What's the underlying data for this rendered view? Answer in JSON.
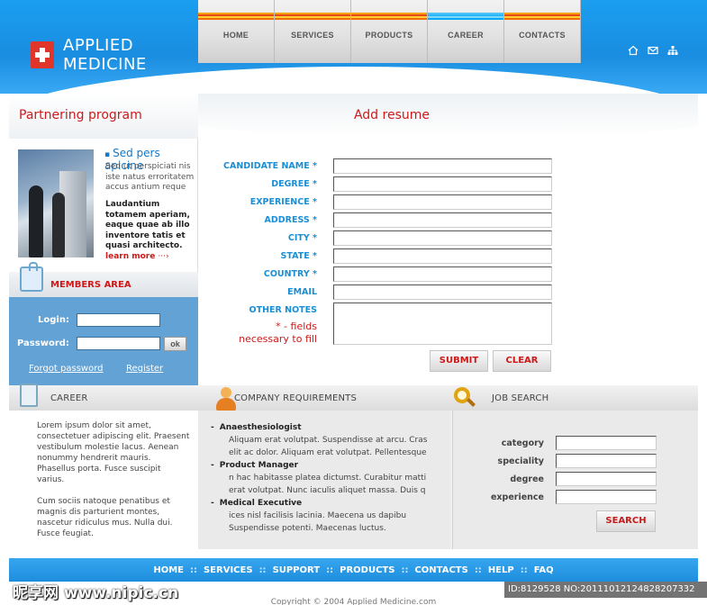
{
  "brand": {
    "line1": "APPLIED",
    "line2": "MEDICINE"
  },
  "nav": [
    {
      "label": "HOME"
    },
    {
      "label": "SERVICES"
    },
    {
      "label": "PRODUCTS"
    },
    {
      "label": "CAREER",
      "active": true
    },
    {
      "label": "CONTACTS"
    }
  ],
  "header_icons": [
    "home-icon",
    "mail-icon",
    "sitemap-icon"
  ],
  "sidebar": {
    "title": "Partnering program",
    "subtitle": "Sed pers apicine",
    "para1": "Sed ut perspiciati nis iste natus erroritatem accus antium reque",
    "para2": "Laudantium totamem aperiam, eaque quae ab illo inventore tatis et quasi architecto.",
    "learn_more": "learn more",
    "members_title": "MEMBERS AREA",
    "login_label": "Login:",
    "password_label": "Password:",
    "ok_label": "ok",
    "forgot": "Forgot password",
    "register": "Register"
  },
  "form": {
    "title": "Add resume",
    "fields": [
      {
        "label": "CANDIDATE NAME *",
        "value": ""
      },
      {
        "label": "DEGREE *",
        "value": ""
      },
      {
        "label": "EXPERIENCE *",
        "value": ""
      },
      {
        "label": "ADDRESS *",
        "value": ""
      },
      {
        "label": "CITY *",
        "value": ""
      },
      {
        "label": "STATE *",
        "value": ""
      },
      {
        "label": "COUNTRY *",
        "value": ""
      },
      {
        "label": "EMAIL",
        "value": ""
      }
    ],
    "notes_label": "OTHER NOTES",
    "required_note_1": "* - fields",
    "required_note_2": "necessary to fill",
    "submit": "SUBMIT",
    "clear": "CLEAR"
  },
  "career": {
    "title": "CAREER",
    "p1": "Lorem ipsum dolor sit amet, consectetuer adipiscing elit. Praesent vestibulum molestie lacus. Aenean nonummy hendrerit mauris. Phasellus porta. Fusce suscipit varius.",
    "p2": "Cum sociis natoque penatibus et magnis dis parturient montes, nascetur ridiculus mus. Nulla dui. Fusce feugiat."
  },
  "requirements": {
    "title": "COMPANY REQUIREMENTS",
    "items": [
      {
        "title": "Anaesthesiologist",
        "desc": "Aliquam erat volutpat. Suspendisse at arcu. Cras elit ac dolor. Aliquam erat volutpat. Pellentesque"
      },
      {
        "title": "Product Manager",
        "desc": "n hac habitasse platea dictumst. Curabitur matti erat volutpat. Nunc iaculis aliquet massa. Duis q"
      },
      {
        "title": "Medical Executive",
        "desc": "ices nisl facilisis lacinia. Maecena us dapibu Suspendisse potenti.  Maecenas luctus."
      }
    ]
  },
  "job_search": {
    "title": "JOB SEARCH",
    "fields": [
      {
        "label": "category"
      },
      {
        "label": "speciality"
      },
      {
        "label": "degree"
      },
      {
        "label": "experience"
      }
    ],
    "button": "SEARCH"
  },
  "footer": {
    "links": [
      "HOME",
      "SERVICES",
      "SUPPORT",
      "PRODUCTS",
      "CONTACTS",
      "HELP",
      "FAQ"
    ],
    "separator": "::",
    "copyright": "Copyright © 2004 Applied Medicine.com"
  },
  "watermark": {
    "left": "昵享网 www.nipic.cn",
    "right": "ID:8129528 NO:20111012124828207332"
  }
}
